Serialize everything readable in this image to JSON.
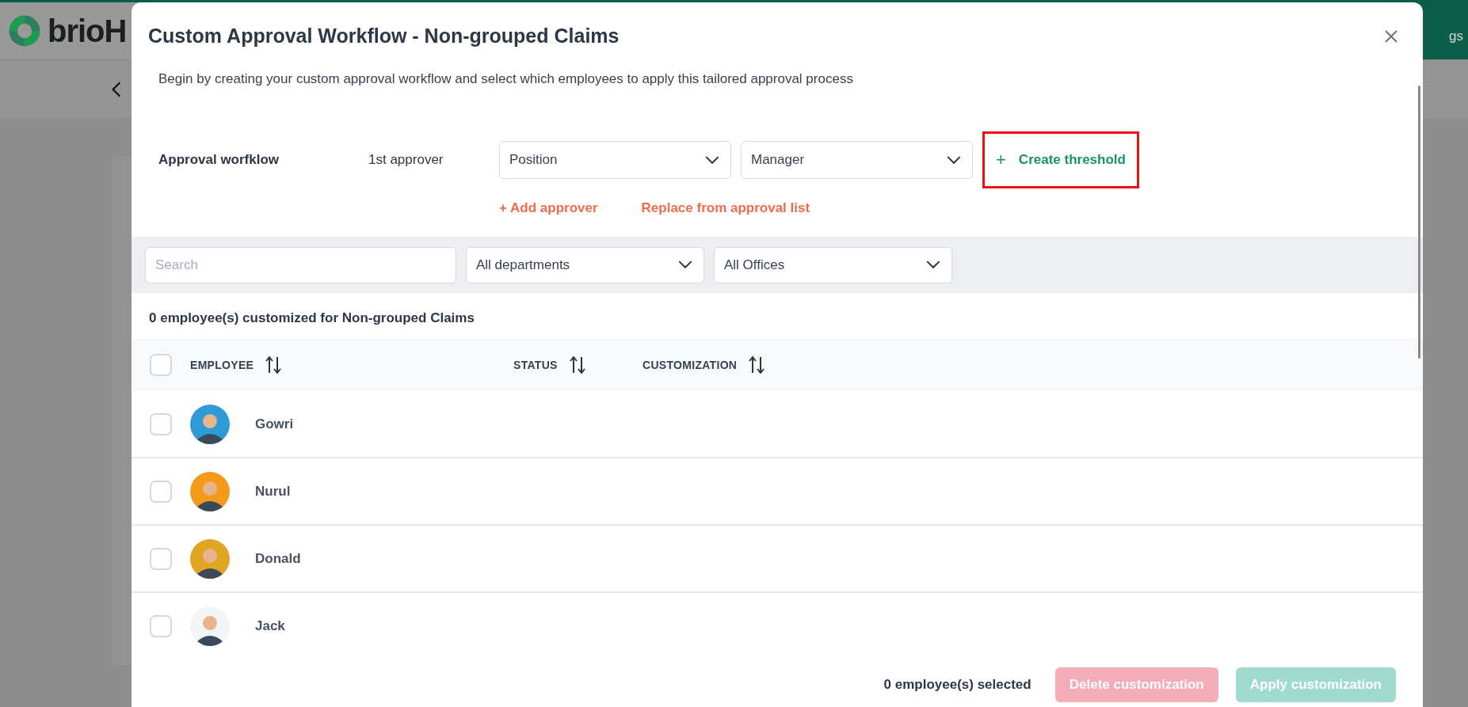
{
  "app": {
    "logo_text": "brioH",
    "header_tab": "gs"
  },
  "dialog": {
    "title": "Custom Approval Workflow - Non-grouped Claims",
    "description": "Begin by creating your custom approval workflow and select which employees to apply this tailored approval process",
    "workflow": {
      "label": "Approval worfklow",
      "step_label": "1st approver",
      "selects": [
        {
          "value": "Position"
        },
        {
          "value": "Manager"
        }
      ],
      "threshold_button": {
        "icon": "+",
        "label": "Create threshold",
        "highlighted": true
      },
      "links": [
        "+ Add approver",
        "Replace from approval list"
      ]
    },
    "filters": {
      "search": {
        "placeholder": "Search"
      },
      "selects": [
        {
          "value": "All departments"
        },
        {
          "value": "All Offices"
        }
      ]
    },
    "summary": "0 employee(s) customized for Non-grouped Claims",
    "table": {
      "select_all": {
        "checked": false
      },
      "columns": [
        "EMPLOYEE",
        "STATUS",
        "CUSTOMIZATION"
      ],
      "rows": [
        {
          "name": "Gowri",
          "checked": false,
          "color": "#2e9bd6"
        },
        {
          "name": "Nurul",
          "checked": false,
          "color": "#f39a1b"
        },
        {
          "name": "Donald",
          "checked": false,
          "color": "#e0a523"
        },
        {
          "name": "Jack",
          "checked": false,
          "color": "#f3f4f6"
        }
      ]
    },
    "footer": {
      "selected_count": "0 employee(s) selected",
      "buttons": [
        {
          "label": "Delete customization",
          "kind": "danger",
          "disabled": true
        },
        {
          "label": "Apply customization",
          "kind": "primary",
          "disabled": true
        }
      ]
    }
  }
}
